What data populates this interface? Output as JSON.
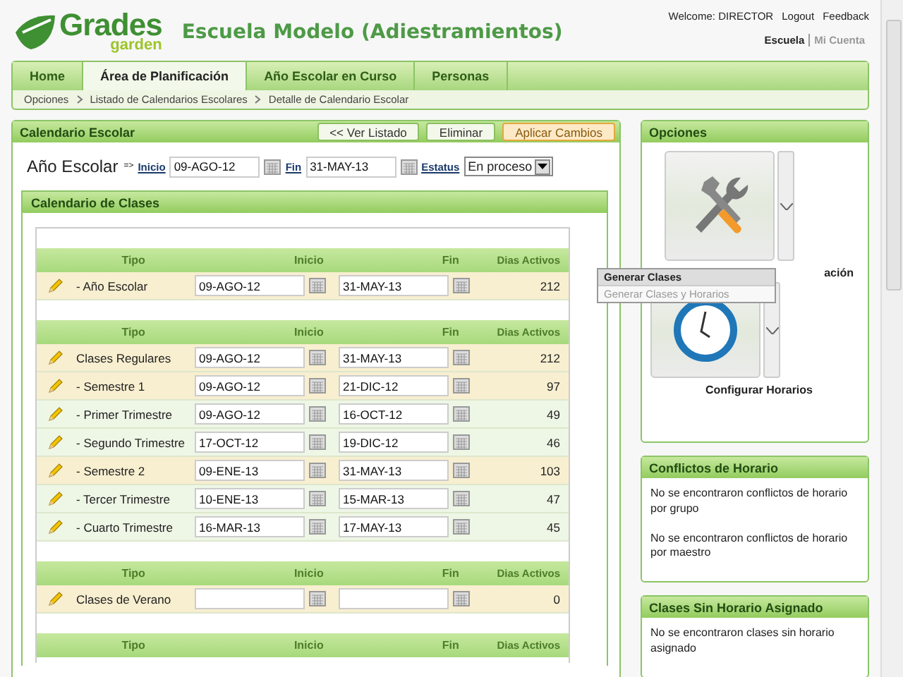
{
  "header": {
    "logo_title": "Grades",
    "logo_sub": "garden",
    "school": "Escuela Modelo (Adiestramientos)",
    "welcome": "Welcome: DIRECTOR",
    "links": [
      "Logout",
      "Feedback"
    ],
    "switch": [
      {
        "label": "Escuela",
        "selected": true
      },
      {
        "label": "Mi Cuenta",
        "selected": false
      }
    ]
  },
  "tabs": [
    {
      "label": "Home",
      "selected": false
    },
    {
      "label": "Área de Planificación",
      "selected": true
    },
    {
      "label": "Año Escolar en Curso",
      "selected": false
    },
    {
      "label": "Personas",
      "selected": false
    }
  ],
  "breadcrumb": [
    "Opciones",
    "Listado de Calendarios Escolares",
    "Detalle de Calendario Escolar"
  ],
  "calendar": {
    "title": "Calendario Escolar",
    "buttons": [
      {
        "label": "<< Ver Listado",
        "kind": "normal"
      },
      {
        "label": "Eliminar",
        "kind": "normal"
      },
      {
        "label": "Aplicar Cambios",
        "kind": "primary"
      }
    ],
    "year": {
      "label": "Año Escolar",
      "arrow": "=>",
      "start_label": "Inicio",
      "start": "09-AGO-12",
      "end_label": "Fin",
      "end": "31-MAY-13",
      "status_label": "Estatus",
      "status": "En proceso"
    },
    "classes": {
      "title": "Calendario de Clases",
      "groups": [
        {
          "columns": [
            "Tipo",
            "Inicio",
            "Fin",
            "Dias Activos"
          ],
          "rows": [
            {
              "type": "- Año Escolar",
              "start": "09-AGO-12",
              "end": "31-MAY-13",
              "days": "212",
              "kind": "period"
            }
          ]
        },
        {
          "columns": [
            "Tipo",
            "Inicio",
            "Fin",
            "Dias Activos"
          ],
          "rows": [
            {
              "type": "Clases Regulares",
              "start": "09-AGO-12",
              "end": "31-MAY-13",
              "days": "212",
              "kind": "period"
            },
            {
              "type": "- Semestre 1",
              "start": "09-AGO-12",
              "end": "21-DIC-12",
              "days": "97",
              "kind": "period"
            },
            {
              "type": "- Primer Trimestre",
              "start": "09-AGO-12",
              "end": "16-OCT-12",
              "days": "49",
              "kind": "trimester"
            },
            {
              "type": "- Segundo Trimestre",
              "start": "17-OCT-12",
              "end": "19-DIC-12",
              "days": "46",
              "kind": "trimester"
            },
            {
              "type": "- Semestre 2",
              "start": "09-ENE-13",
              "end": "31-MAY-13",
              "days": "103",
              "kind": "period"
            },
            {
              "type": "- Tercer Trimestre",
              "start": "10-ENE-13",
              "end": "15-MAR-13",
              "days": "47",
              "kind": "trimester"
            },
            {
              "type": "- Cuarto Trimestre",
              "start": "16-MAR-13",
              "end": "17-MAY-13",
              "days": "45",
              "kind": "trimester"
            }
          ]
        },
        {
          "columns": [
            "Tipo",
            "Inicio",
            "Fin",
            "Dias Activos"
          ],
          "rows": [
            {
              "type": "Clases de Verano",
              "days": "0",
              "kind": "period"
            }
          ]
        },
        {
          "columns": [
            "Tipo",
            "Inicio",
            "Fin",
            "Dias Activos"
          ]
        }
      ]
    }
  },
  "options": {
    "title": "Opciones",
    "tiles": [
      {
        "label": "ación"
      },
      {
        "label": "Configurar Horarios"
      }
    ],
    "menu": [
      {
        "label": "Generar Clases",
        "disabled": false
      },
      {
        "label": "Generar Clases y Horarios",
        "disabled": true
      }
    ]
  },
  "panels": [
    {
      "title": "Conflictos de Horario",
      "messages": [
        "No se encontraron conflictos de horario por grupo",
        "No se encontraron conflictos de horario por maestro"
      ]
    },
    {
      "title": "Clases Sin Horario Asignado",
      "messages": [
        "No se encontraron clases sin horario asignado"
      ]
    }
  ]
}
